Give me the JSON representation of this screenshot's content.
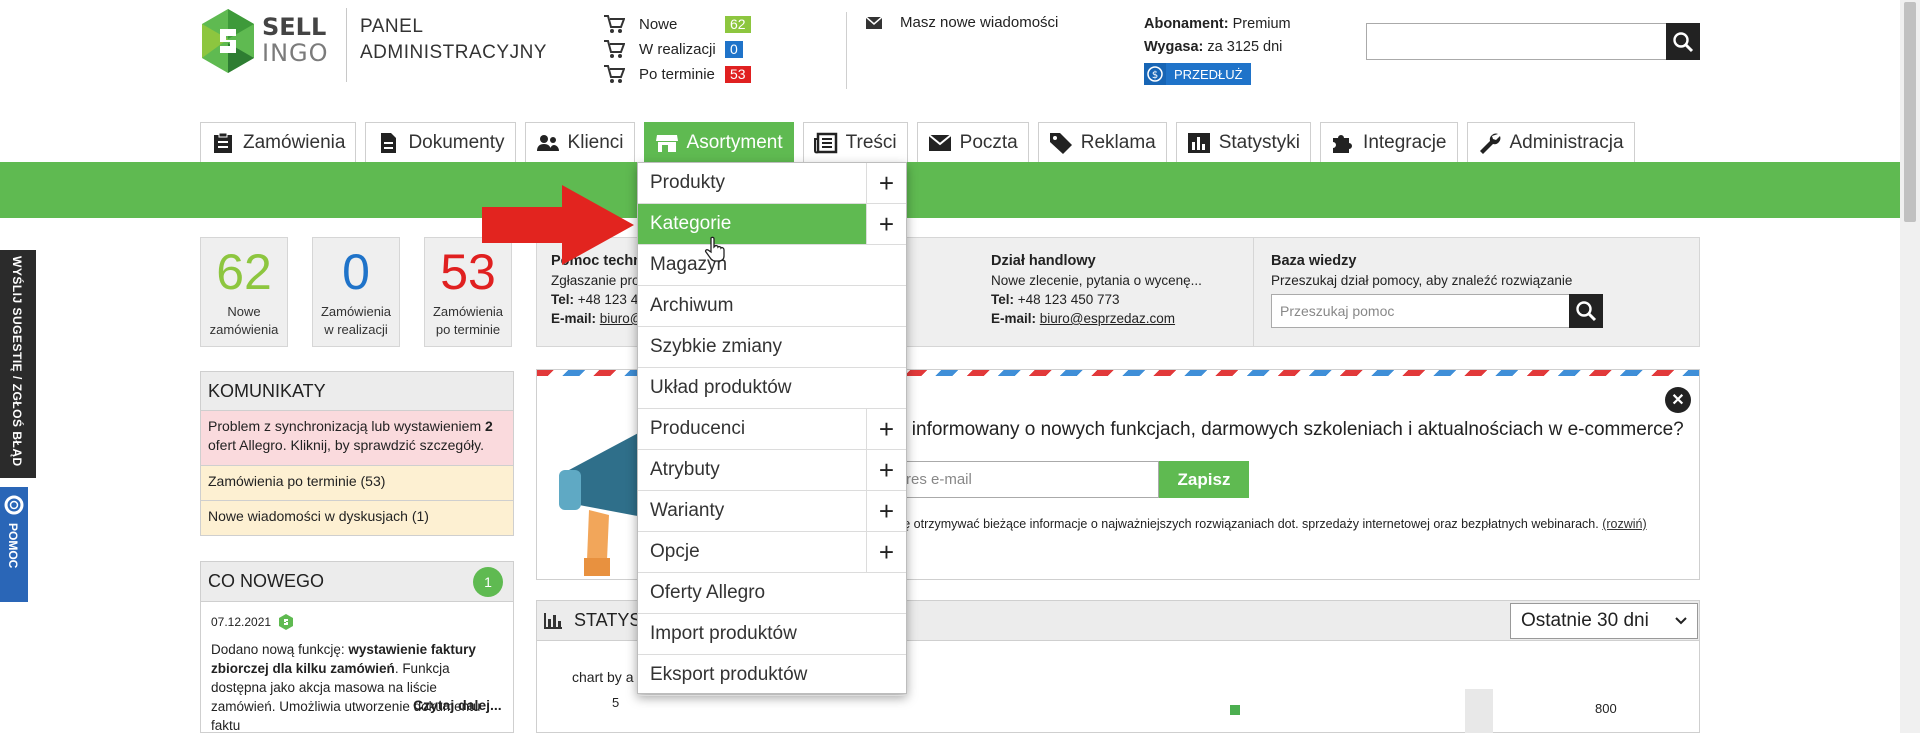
{
  "header": {
    "logo_top": "SELL",
    "logo_bottom": "INGO",
    "panel_title_line1": "PANEL",
    "panel_title_line2": "ADMINISTRACYJNY",
    "order_stats": [
      {
        "label": "Nowe",
        "value": "62",
        "color": "#8dc63f"
      },
      {
        "label": "W realizacji",
        "value": "0",
        "color": "#1f73c9"
      },
      {
        "label": "Po terminie",
        "value": "53",
        "color": "#e02020"
      }
    ],
    "messages": "Masz nowe wiadomości",
    "subscription_label": "Abonament:",
    "subscription_value": "Premium",
    "expires_label": "Wygasa:",
    "expires_value": "za 3125 dni",
    "extend_button": "PRZEDŁUŻ"
  },
  "nav": {
    "tabs": [
      {
        "label": "Zamówienia",
        "icon": "clipboard-icon"
      },
      {
        "label": "Dokumenty",
        "icon": "document-icon"
      },
      {
        "label": "Klienci",
        "icon": "users-icon"
      },
      {
        "label": "Asortyment",
        "icon": "store-icon",
        "active": true
      },
      {
        "label": "Treści",
        "icon": "newspaper-icon"
      },
      {
        "label": "Poczta",
        "icon": "envelope-icon"
      },
      {
        "label": "Reklama",
        "icon": "tag-icon"
      },
      {
        "label": "Statystyki",
        "icon": "chart-icon"
      },
      {
        "label": "Integracje",
        "icon": "puzzle-icon"
      },
      {
        "label": "Administracja",
        "icon": "wrench-icon"
      }
    ]
  },
  "dropdown": {
    "items": [
      {
        "label": "Produkty",
        "plus": true
      },
      {
        "label": "Kategorie",
        "plus": true,
        "highlighted": true
      },
      {
        "label": "Magazyn",
        "plus": false
      },
      {
        "label": "Archiwum",
        "plus": false
      },
      {
        "label": "Szybkie zmiany",
        "plus": false
      },
      {
        "label": "Układ produktów",
        "plus": false
      },
      {
        "label": "Producenci",
        "plus": true
      },
      {
        "label": "Atrybuty",
        "plus": true
      },
      {
        "label": "Warianty",
        "plus": true
      },
      {
        "label": "Opcje",
        "plus": true
      },
      {
        "label": "Oferty Allegro",
        "plus": false
      },
      {
        "label": "Import produktów",
        "plus": false
      },
      {
        "label": "Eksport produktów",
        "plus": false
      }
    ],
    "plus_symbol": "+"
  },
  "side_tabs": {
    "suggest": "WYŚLIJ SUGESTIĘ / ZGŁOŚ BŁĄD",
    "help": "POMOC"
  },
  "stat_boxes": [
    {
      "value": "62",
      "line1": "Nowe",
      "line2": "zamówienia",
      "color": "#8dc63f"
    },
    {
      "value": "0",
      "line1": "Zamówienia",
      "line2": "w realizacji",
      "color": "#1f73c9"
    },
    {
      "value": "53",
      "line1": "Zamówienia",
      "line2": "po terminie",
      "color": "#e02020"
    }
  ],
  "contacts": {
    "support": {
      "title": "Pomoc techn",
      "desc": "Zgłaszanie prob",
      "tel_label": "Tel:",
      "tel": "+48 123 45",
      "email_label": "E-mail:",
      "email": "biuro@"
    },
    "sales": {
      "title": "Dział handlowy",
      "desc": "Nowe zlecenie, pytania o wycenę...",
      "tel_label": "Tel:",
      "tel": "+48 123 450 773",
      "email_label": "E-mail:",
      "email": "biuro@esprzedaz.com"
    },
    "knowledge": {
      "title": "Baza wiedzy",
      "desc": "Przeszukaj dział pomocy, aby znaleźć rozwiązanie",
      "placeholder": "Przeszukaj pomoc"
    }
  },
  "komunikaty": {
    "title": "KOMUNIKATY",
    "items": [
      {
        "pre": "Problem z synchronizacją lub wystawieniem ",
        "bold": "2",
        "post": " ofert Allegro. Kliknij, by sprawdzić szczegóły."
      },
      {
        "text": "Zamówienia po terminie (53)"
      },
      {
        "text": "Nowe wiadomości w dyskusjach (1)"
      }
    ]
  },
  "news": {
    "title": "CO NOWEGO",
    "count": "1",
    "date": "07.12.2021",
    "text_pre": "Dodano nową funkcję: ",
    "text_bold": "wystawienie faktury zbiorczej dla kilku zamówień",
    "text_post": ". Funkcja dostępna jako akcja masowa na liście zamówień. Umożliwia utworzenie dokumentu faktu",
    "more": "Czytaj dalej..."
  },
  "newsletter": {
    "heading": "ć informowany o nowych funkcjach, darmowych szkoleniach i aktualnościach w e-commerce?",
    "email_placeholder": "res e-mail",
    "submit": "Zapisz",
    "consent": "cę otrzymywać bieżące informacje o najważniejszych rozwiązaniach dot. sprzedaży internetowej oraz bezpłatnych webinarach.",
    "consent_link": "(rozwiń)",
    "close": "✕"
  },
  "stats": {
    "title": "STATYS",
    "period": "Ostatnie 30 dni",
    "chart_title": "chart by a",
    "tick_left": "5",
    "tick_right": "800"
  }
}
